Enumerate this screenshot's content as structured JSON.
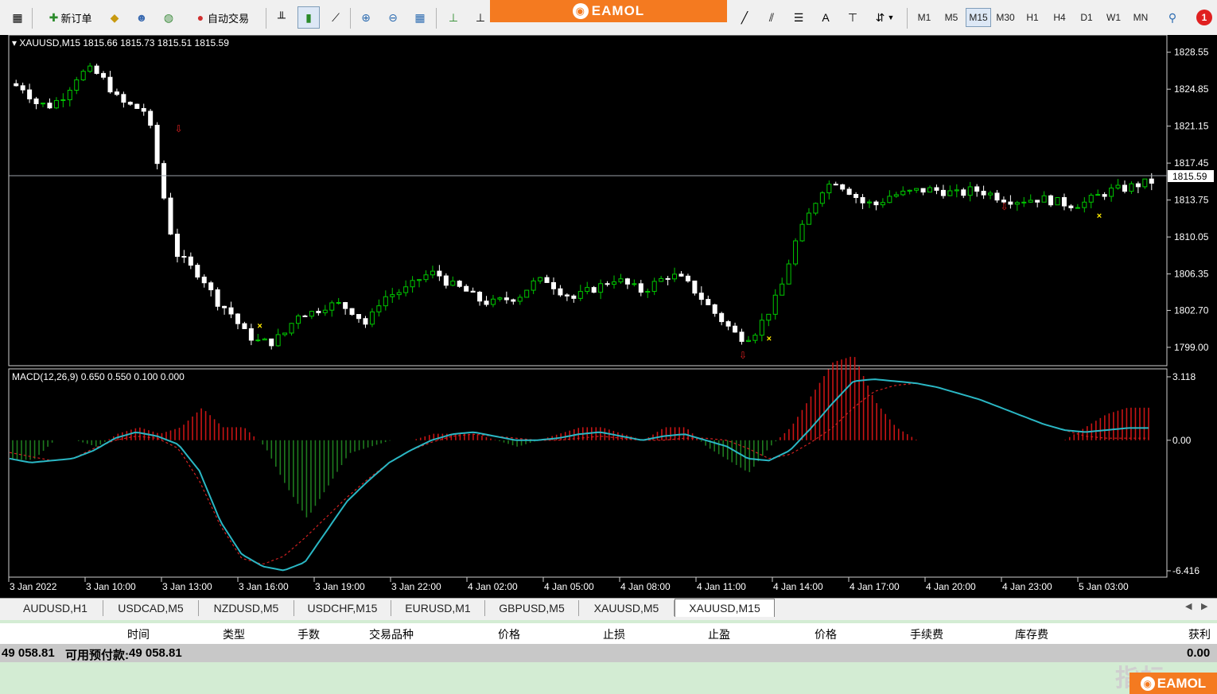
{
  "toolbar": {
    "new_order_label": "新订单",
    "auto_trade_label": "自动交易",
    "brand_label": "EAMOL",
    "text_tool_label": "A",
    "notification_count": "1",
    "timeframes": [
      "M1",
      "M5",
      "M15",
      "M30",
      "H1",
      "H4",
      "D1",
      "W1",
      "MN"
    ],
    "active_timeframe": "M15"
  },
  "chart": {
    "info_label": "XAUUSD,M15  1815.66 1815.73 1815.51 1815.59",
    "macd_label": "MACD(12,26,9) 0.650 0.550 0.100 0.000",
    "current_price": "1815.59",
    "price_ticks": [
      "1828.55",
      "1824.85",
      "1821.15",
      "1817.45",
      "1813.75",
      "1810.05",
      "1806.35",
      "1802.70",
      "1799.00"
    ],
    "macd_ticks": [
      "3.118",
      "0.00",
      "-6.416"
    ],
    "time_labels": [
      "3 Jan 2022",
      "3 Jan 10:00",
      "3 Jan 13:00",
      "3 Jan 16:00",
      "3 Jan 19:00",
      "3 Jan 22:00",
      "4 Jan 02:00",
      "4 Jan 05:00",
      "4 Jan 08:00",
      "4 Jan 11:00",
      "4 Jan 14:00",
      "4 Jan 17:00",
      "4 Jan 20:00",
      "4 Jan 23:00",
      "5 Jan 03:00"
    ],
    "colors": {
      "background": "#000000",
      "bull": "#00c800",
      "bear": "#ffffff",
      "macd_line": "#2ab7c4",
      "signal_line": "#d02020",
      "hist_pos": "#c81414",
      "hist_neg": "#1e7a1e"
    }
  },
  "chart_data": {
    "type": "candlestick",
    "symbol": "XAUUSD",
    "timeframe": "M15",
    "ylim": [
      1797.8,
      1829.8
    ],
    "price_path": [
      1825.4,
      1825.0,
      1823.4,
      1823.2,
      1824.3,
      1826.3,
      1826.8,
      1825.6,
      1823.6,
      1823.1,
      1822.6,
      1815.6,
      1808.6,
      1807.2,
      1806.1,
      1803.7,
      1802.6,
      1800.6,
      1799.6,
      1799.5,
      1800.4,
      1802.4,
      1802.5,
      1803.2,
      1803.3,
      1802.6,
      1801.2,
      1803.9,
      1804.4,
      1804.9,
      1806.1,
      1806.5,
      1805.3,
      1804.8,
      1803.8,
      1803.4,
      1803.8,
      1804.1,
      1805.4,
      1805.8,
      1804.7,
      1803.9,
      1804.6,
      1805.2,
      1805.9,
      1805.2,
      1804.6,
      1805.5,
      1806.3,
      1805.7,
      1804.4,
      1802.8,
      1801.4,
      1800.0,
      1800.2,
      1802.2,
      1804.6,
      1809.2,
      1812.0,
      1814.8,
      1815.7,
      1814.7,
      1813.5,
      1813.3,
      1814.2,
      1814.4,
      1814.7,
      1814.8,
      1814.6,
      1814.3,
      1814.8,
      1814.5,
      1814.0,
      1813.7,
      1813.8,
      1813.9,
      1813.6,
      1813.3,
      1813.4,
      1814.1,
      1814.7,
      1814.9,
      1815.3,
      1815.6
    ],
    "macd_ylim": [
      -6.416,
      3.118
    ],
    "macd_path": [
      -0.9,
      -1.1,
      -1.0,
      -0.9,
      -0.5,
      0.1,
      0.4,
      0.2,
      -0.2,
      -1.5,
      -4.0,
      -5.6,
      -6.2,
      -6.4,
      -6.0,
      -4.5,
      -3.0,
      -2.0,
      -1.1,
      -0.5,
      0.0,
      0.3,
      0.4,
      0.2,
      0.0,
      0.0,
      0.1,
      0.3,
      0.4,
      0.2,
      0.0,
      0.2,
      0.3,
      0.0,
      -0.3,
      -0.9,
      -1.0,
      -0.5,
      0.6,
      1.8,
      2.9,
      3.0,
      2.9,
      2.8,
      2.6,
      2.3,
      2.0,
      1.6,
      1.2,
      0.8,
      0.5,
      0.4,
      0.5,
      0.6,
      0.6
    ],
    "signal_path": [
      -0.6,
      -0.8,
      -1.0,
      -0.9,
      -0.4,
      0.0,
      0.2,
      0.1,
      -0.4,
      -2.0,
      -4.2,
      -5.8,
      -6.1,
      -5.7,
      -4.8,
      -3.8,
      -2.8,
      -1.9,
      -1.1,
      -0.5,
      -0.1,
      0.2,
      0.3,
      0.2,
      0.1,
      0.0,
      0.0,
      0.1,
      0.2,
      0.1,
      0.0,
      0.0,
      0.1,
      0.1,
      0.0,
      -0.4,
      -0.9,
      -0.7,
      -0.1,
      0.6,
      1.6,
      2.4,
      2.7,
      2.8,
      2.6,
      2.3,
      2.0,
      1.6,
      1.2,
      0.8,
      0.5,
      0.2,
      0.1,
      0.1,
      0.1
    ],
    "signals": [
      {
        "type": "buy_x",
        "index": 18,
        "price": 1801.2
      },
      {
        "type": "sell_arrow",
        "index": 12,
        "price": 1820.9
      },
      {
        "type": "buy_x",
        "index": 55,
        "price": 1799.9
      },
      {
        "type": "sell_arrow",
        "index": 53,
        "price": 1798.2
      },
      {
        "type": "sell_arrow",
        "index": 72,
        "price": 1813.1
      },
      {
        "type": "buy_x",
        "index": 79,
        "price": 1812.2
      }
    ]
  },
  "tabs": [
    "AUDUSD,H1",
    "USDCAD,M5",
    "NZDUSD,M5",
    "USDCHF,M15",
    "EURUSD,M1",
    "GBPUSD,M5",
    "XAUUSD,M5",
    "XAUUSD,M15"
  ],
  "active_tab": "XAUUSD,M15",
  "terminal": {
    "columns": [
      "时间",
      "类型",
      "手数",
      "交易品种",
      "价格",
      "止损",
      "止盈",
      "价格",
      "手续费",
      "库存费",
      "获利"
    ],
    "balance": "49 058.81",
    "free_margin_label": "可用预付款:",
    "free_margin": "49 058.81",
    "profit": "0.00"
  },
  "watermark": {
    "text": "指标",
    "brand": "EAMOL"
  }
}
